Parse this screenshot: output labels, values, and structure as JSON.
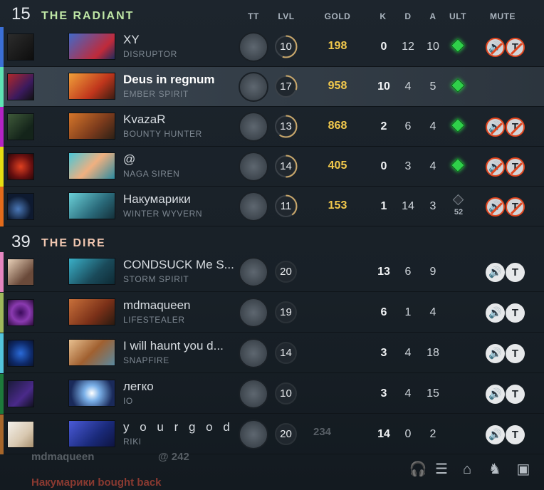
{
  "columns": {
    "tt": "TT",
    "lvl": "LVL",
    "gold": "GOLD",
    "k": "K",
    "d": "D",
    "a": "A",
    "ult": "ULT",
    "mute": "MUTE"
  },
  "radiant": {
    "score": "15",
    "name": "THE RADIANT",
    "players": [
      {
        "name": "XY",
        "hero": "DISRUPTOR",
        "level": "10",
        "level_progress": 0.55,
        "gold": "198",
        "k": "0",
        "d": "12",
        "a": "10",
        "ult": "ready",
        "stripe": "#3b6fd6"
      },
      {
        "name": "Deus in regnum",
        "hero": "EMBER SPIRIT",
        "level": "17",
        "level_progress": 0.3,
        "gold": "958",
        "k": "10",
        "d": "4",
        "a": "5",
        "ult": "ready",
        "stripe": "#5fe3b5"
      },
      {
        "name": "KvazaR",
        "hero": "BOUNTY HUNTER",
        "level": "13",
        "level_progress": 0.6,
        "gold": "868",
        "k": "2",
        "d": "6",
        "a": "4",
        "ult": "ready",
        "stripe": "#b324c4"
      },
      {
        "name": "@",
        "hero": "NAGA SIREN",
        "level": "14",
        "level_progress": 0.5,
        "gold": "405",
        "k": "0",
        "d": "3",
        "a": "4",
        "ult": "ready",
        "stripe": "#e6dd12"
      },
      {
        "name": "Накумарики",
        "hero": "WINTER WYVERN",
        "level": "11",
        "level_progress": 0.4,
        "gold": "153",
        "k": "1",
        "d": "14",
        "a": "3",
        "ult": "52",
        "stripe": "#e36b1b"
      }
    ]
  },
  "dire": {
    "score": "39",
    "name": "THE DIRE",
    "players": [
      {
        "name": "CONDSUCK Me S...",
        "hero": "STORM SPIRIT",
        "level": "20",
        "k": "13",
        "d": "6",
        "a": "9",
        "stripe": "#e586c0"
      },
      {
        "name": "mdmaqueen",
        "hero": "LIFESTEALER",
        "level": "19",
        "k": "6",
        "d": "1",
        "a": "4",
        "stripe": "#9fb85b"
      },
      {
        "name": "I will haunt you d...",
        "hero": "SNAPFIRE",
        "level": "14",
        "k": "3",
        "d": "4",
        "a": "18",
        "stripe": "#53c4dc"
      },
      {
        "name": "легко",
        "hero": "IO",
        "level": "10",
        "k": "3",
        "d": "4",
        "a": "15",
        "stripe": "#1d7a3b"
      },
      {
        "name": "y o u r  g o d",
        "hero": "RIKI",
        "level": "20",
        "k": "14",
        "d": "0",
        "a": "2",
        "stripe": "#a7662a"
      }
    ]
  },
  "mute_labels": {
    "text_mute": "T"
  },
  "feed": {
    "line1_name": "mdmaqueen",
    "line1_value": "@ 242",
    "line2": "Накумарики bought back",
    "line0_value": "234"
  },
  "icons": {
    "talent": "talent-tree-icon",
    "voice": "speaker-icon",
    "text": "text-chat-icon",
    "tools": [
      "headset-icon",
      "clipboard-icon",
      "share-control-icon",
      "courier-icon",
      "settings-panel-icon"
    ]
  }
}
